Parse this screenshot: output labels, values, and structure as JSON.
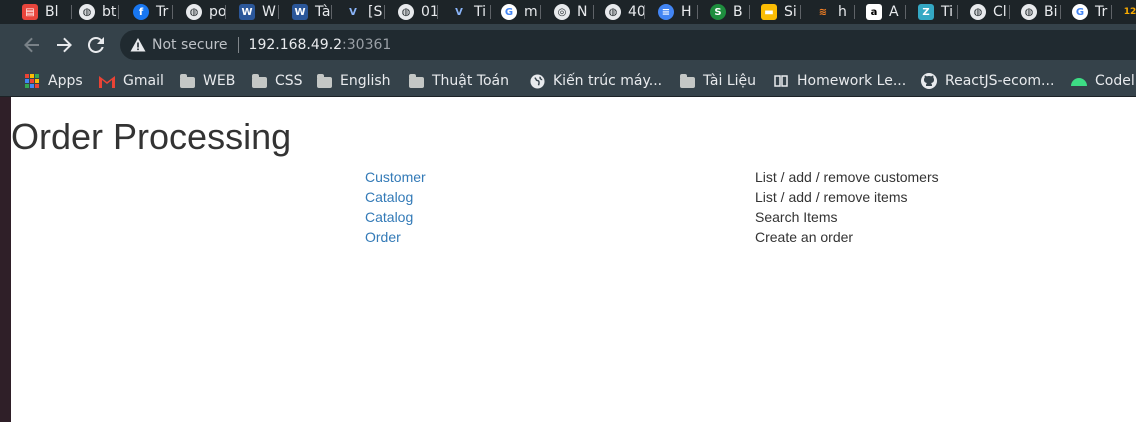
{
  "tabs": [
    {
      "label": "Bl",
      "icon": "pdf-icon",
      "color": "#e8453c"
    },
    {
      "label": "bt",
      "icon": "globe-icon",
      "color": "#e8eaed"
    },
    {
      "label": "Tr",
      "icon": "facebook-icon",
      "color": "#1877f2"
    },
    {
      "label": "po",
      "icon": "globe-icon",
      "color": "#e8eaed"
    },
    {
      "label": "W",
      "icon": "word-icon",
      "color": "#2b579a"
    },
    {
      "label": "Tà",
      "icon": "word-icon",
      "color": "#2b579a"
    },
    {
      "label": "[S",
      "icon": "v-icon",
      "color": "#8ab4f8"
    },
    {
      "label": "01",
      "icon": "globe-icon",
      "color": "#e8eaed"
    },
    {
      "label": "Ti",
      "icon": "v-icon",
      "color": "#8ab4f8"
    },
    {
      "label": "m",
      "icon": "google-icon",
      "color": "#ffffff"
    },
    {
      "label": "N",
      "icon": "chrome-icon",
      "color": "#e8eaed"
    },
    {
      "label": "40",
      "icon": "globe-icon",
      "color": "#e8eaed"
    },
    {
      "label": "H",
      "icon": "sphere-icon",
      "color": "#4285f4"
    },
    {
      "label": "B",
      "icon": "s-icon",
      "color": "#1e8e3e"
    },
    {
      "label": "Si",
      "icon": "folder-icon",
      "color": "#fbbc04"
    },
    {
      "label": "h",
      "icon": "stackoverflow-icon",
      "color": "#f48024"
    },
    {
      "label": "A",
      "icon": "amazon-icon",
      "color": "#ffffff"
    },
    {
      "label": "Ti",
      "icon": "z-icon",
      "color": "#34a8c4"
    },
    {
      "label": "Cl",
      "icon": "globe-icon",
      "color": "#e8eaed"
    },
    {
      "label": "Bi",
      "icon": "globe-icon",
      "color": "#e8eaed"
    },
    {
      "label": "Tr",
      "icon": "google-icon",
      "color": "#ffffff"
    },
    {
      "label": "",
      "icon": "number-icon",
      "color": "#f9ab00"
    }
  ],
  "toolbar": {
    "back_icon": "back-arrow-icon",
    "forward_icon": "forward-arrow-icon",
    "reload_icon": "reload-icon",
    "security_label": "Not secure",
    "url_host": "192.168.49.2",
    "url_port": ":30361"
  },
  "bookmarks": [
    {
      "label": "Apps",
      "icon": "apps-grid-icon"
    },
    {
      "label": "Gmail",
      "icon": "gmail-icon"
    },
    {
      "label": "WEB",
      "icon": "folder-icon"
    },
    {
      "label": "CSS",
      "icon": "folder-icon"
    },
    {
      "label": "English",
      "icon": "folder-icon"
    },
    {
      "label": "Thuật Toán",
      "icon": "folder-icon"
    },
    {
      "label": "Kiến trúc máy...",
      "icon": "globe-icon"
    },
    {
      "label": "Tài Liệu",
      "icon": "folder-icon"
    },
    {
      "label": "Homework Le...",
      "icon": "book-icon"
    },
    {
      "label": "ReactJS-ecom...",
      "icon": "github-icon"
    },
    {
      "label": "Codel",
      "icon": "android-icon"
    }
  ],
  "page": {
    "title": "Order Processing",
    "link_color": "#337ab7",
    "rows": [
      {
        "link": "Customer",
        "description": "List / add / remove customers"
      },
      {
        "link": "Catalog",
        "description": "List / add / remove items"
      },
      {
        "link": "Catalog",
        "description": "Search Items"
      },
      {
        "link": "Order",
        "description": "Create an order"
      }
    ]
  }
}
